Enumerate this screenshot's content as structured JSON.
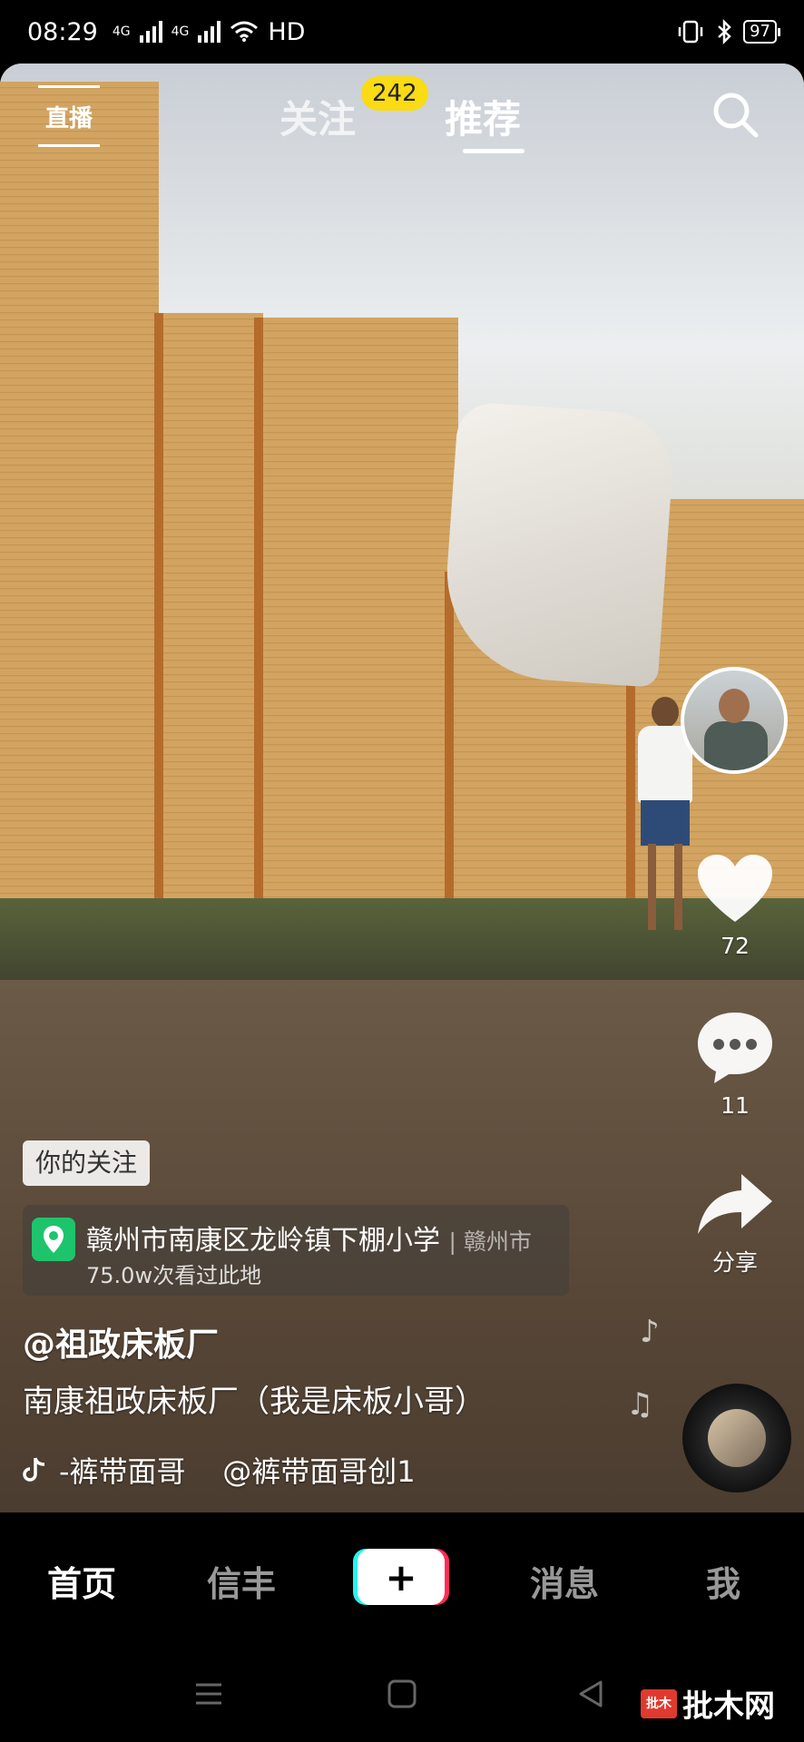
{
  "status_bar": {
    "time": "08:29",
    "network_1": "4G",
    "network_2": "4G",
    "hd": "HD",
    "battery": "97"
  },
  "top_bar": {
    "live_label": "直播",
    "tab_following": "关注",
    "following_badge": "242",
    "tab_recommended": "推荐"
  },
  "side_rail": {
    "like_count": "72",
    "comment_count": "11",
    "share_label": "分享"
  },
  "video_info": {
    "follow_tag": "你的关注",
    "location_title": "赣州市南康区龙岭镇下棚小学",
    "location_city": "| 赣州市",
    "location_views": "75.0w次看过此地",
    "author": "@祖政床板厂",
    "description": "南康祖政床板厂（我是床板小哥）",
    "music": "-裤带面哥    @裤带面哥创1"
  },
  "bottom_nav": {
    "home": "首页",
    "friends": "信丰",
    "plus": "+",
    "messages": "消息",
    "me": "我"
  },
  "watermark": {
    "logo_text": "批木",
    "text": "批木网"
  },
  "colors": {
    "badge": "#fadb14",
    "location_pin": "#1ec46b",
    "plus_left": "#25f4ee",
    "plus_right": "#fe2c55"
  }
}
